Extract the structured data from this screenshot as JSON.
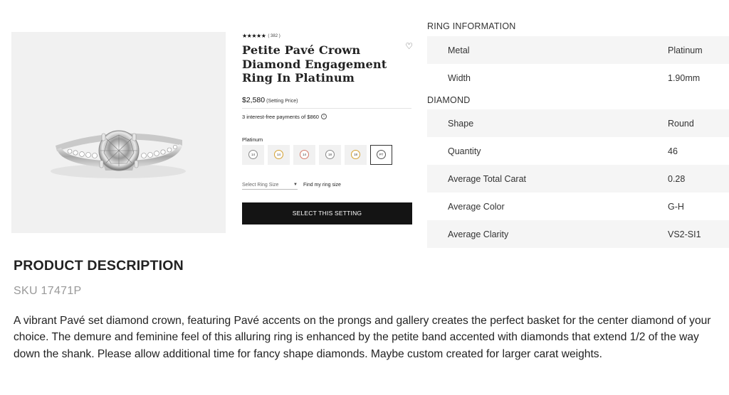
{
  "product": {
    "stars": "★★★★★",
    "review_count": "( 382 )",
    "title": "Petite Pavé Crown Diamond Engagement Ring In Platinum",
    "price": "$2,580",
    "price_note": "(Setting Price)",
    "installments": "3 interest-free payments of $860",
    "metal_label": "Platinum",
    "swatches": [
      {
        "label": "14",
        "color": "#8a8a8a"
      },
      {
        "label": "14",
        "color": "#d4a030"
      },
      {
        "label": "14",
        "color": "#d47a6a"
      },
      {
        "label": "18",
        "color": "#8a8a8a"
      },
      {
        "label": "18",
        "color": "#d4a030"
      },
      {
        "label": "PT",
        "color": "#555555"
      }
    ],
    "size_select_placeholder": "Select Ring Size",
    "find_size_link": "Find my ring size",
    "cta_label": "SELECT THIS SETTING"
  },
  "ring_information": {
    "heading": "RING INFORMATION",
    "rows": [
      {
        "label": "Metal",
        "value": "Platinum"
      },
      {
        "label": "Width",
        "value": "1.90mm"
      }
    ]
  },
  "diamond": {
    "heading": "DIAMOND",
    "rows": [
      {
        "label": "Shape",
        "value": "Round"
      },
      {
        "label": "Quantity",
        "value": "46"
      },
      {
        "label": "Average Total Carat",
        "value": "0.28"
      },
      {
        "label": "Average Color",
        "value": "G-H"
      },
      {
        "label": "Average Clarity",
        "value": "VS2-SI1"
      }
    ]
  },
  "description": {
    "title": "PRODUCT DESCRIPTION",
    "sku": "SKU 17471P",
    "text": "A vibrant Pavé set diamond crown, featuring Pavé accents on the prongs and gallery creates the perfect basket for the center diamond of your choice. The demure and feminine feel of this alluring ring is enhanced by the petite band accented with diamonds that extend 1/2 of the way down the shank. Please allow additional time for fancy shape diamonds. Maybe custom created for larger carat weights."
  }
}
